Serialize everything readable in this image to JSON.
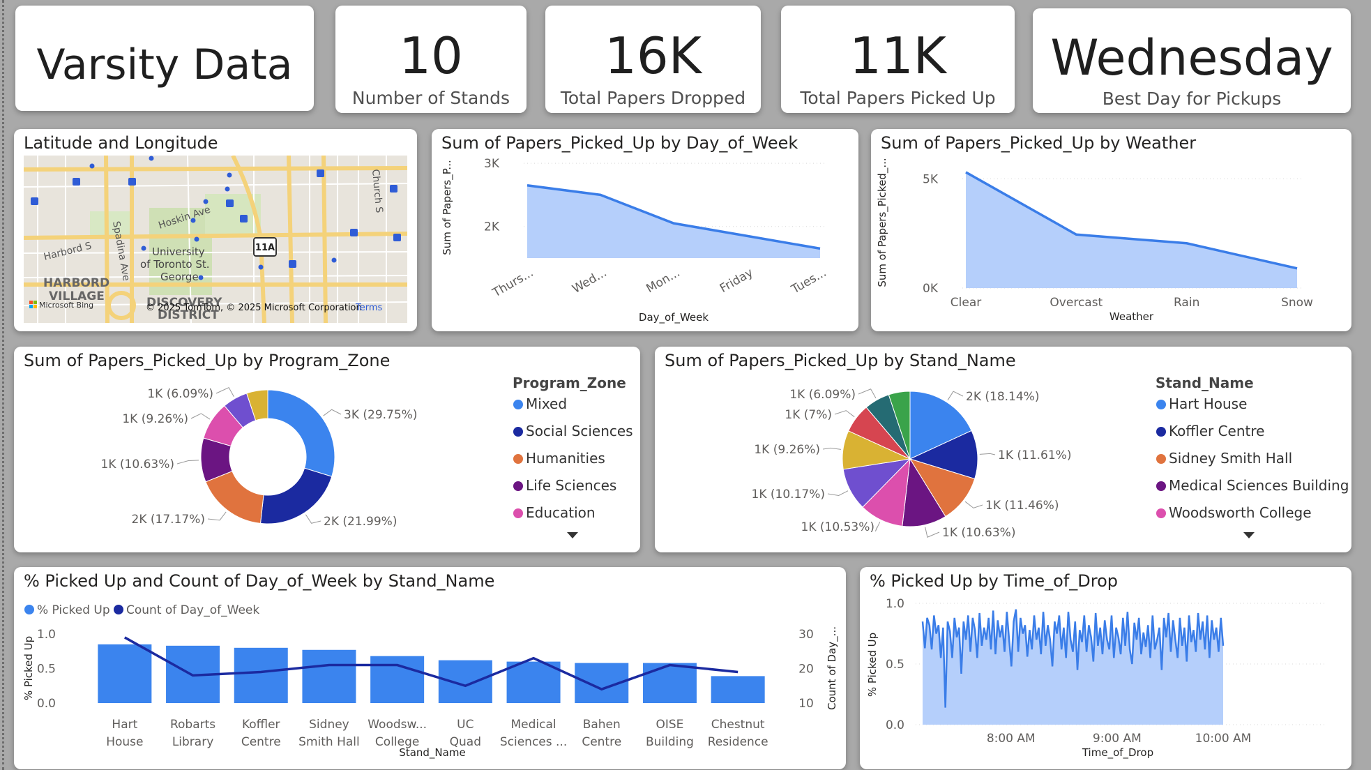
{
  "kpis": {
    "title": "Varsity Data",
    "stands_value": "10",
    "stands_label": "Number of Stands",
    "dropped_value": "16K",
    "dropped_label": "Total Papers Dropped",
    "picked_value": "11K",
    "picked_label": "Total Papers Picked Up",
    "bestday_value": "Wednesday",
    "bestday_label": "Best Day for Pickups"
  },
  "map": {
    "title": "Latitude and Longitude",
    "labels": [
      "Hoskin Ave",
      "University",
      "of Toronto St.",
      "George",
      "HARBORD",
      "VILLAGE",
      "DISCOVERY",
      "DISTRICT",
      "Harbord S",
      "Spadina Ave",
      "Church S",
      "11A"
    ],
    "attribution": "© 2025 TomTom, © 2025 Microsoft Corporation",
    "terms": "Terms",
    "bing": "Microsoft Bing",
    "colors": {
      "background": "#e8e4dc",
      "park": "#cfe0b5",
      "major_road": "#f4d27a",
      "minor_road": "#ffffff",
      "pin": "#2f5cd6"
    }
  },
  "chart_data": [
    {
      "id": "day_of_week",
      "type": "area",
      "title": "Sum of Papers_Picked_Up by Day_of_Week",
      "xlabel": "Day_of_Week",
      "ylabel": "Sum of Papers_P...",
      "categories": [
        "Thurs...",
        "Wed...",
        "Mon...",
        "Friday",
        "Tues..."
      ],
      "values": [
        2650,
        2500,
        2050,
        1850,
        1650
      ],
      "yticks": [
        "2K",
        "3K"
      ],
      "ylim": [
        1500,
        3100
      ],
      "color": "#3a7de8"
    },
    {
      "id": "weather",
      "type": "area",
      "title": "Sum of Papers_Picked_Up by Weather",
      "xlabel": "Weather",
      "ylabel": "Sum of Papers_Picked_...",
      "categories": [
        "Clear",
        "Overcast",
        "Rain",
        "Snow"
      ],
      "values": [
        5300,
        2450,
        2050,
        900
      ],
      "yticks": [
        "0K",
        "5K"
      ],
      "ylim": [
        0,
        6000
      ],
      "color": "#3a7de8"
    },
    {
      "id": "program_zone",
      "type": "pie",
      "donut": true,
      "title": "Sum of Papers_Picked_Up by Program_Zone",
      "legend_title": "Program_Zone",
      "legend": [
        "Mixed",
        "Social Sciences",
        "Humanities",
        "Life Sciences",
        "Education"
      ],
      "slices": [
        {
          "label": "3K (29.75%)",
          "value": 29.75,
          "color": "#3b84ee"
        },
        {
          "label": "2K (21.99%)",
          "value": 21.99,
          "color": "#1b2aa0"
        },
        {
          "label": "2K (17.17%)",
          "value": 17.17,
          "color": "#e0733e"
        },
        {
          "label": "1K (10.63%)",
          "value": 10.63,
          "color": "#6b1582"
        },
        {
          "label": "1K (9.26%)",
          "value": 9.26,
          "color": "#dc4fad"
        },
        {
          "label": "1K (6.09%)",
          "value": 6.09,
          "color": "#6f4fcf"
        },
        {
          "label": "",
          "value": 5.11,
          "color": "#d9b233"
        }
      ]
    },
    {
      "id": "stand_name",
      "type": "pie",
      "donut": false,
      "title": "Sum of Papers_Picked_Up by Stand_Name",
      "legend_title": "Stand_Name",
      "legend": [
        "Hart House",
        "Koffler Centre",
        "Sidney Smith Hall",
        "Medical Sciences Building",
        "Woodsworth College"
      ],
      "slices": [
        {
          "label": "2K (18.14%)",
          "value": 18.14,
          "color": "#3b84ee"
        },
        {
          "label": "1K (11.61%)",
          "value": 11.61,
          "color": "#1b2aa0"
        },
        {
          "label": "1K (11.46%)",
          "value": 11.46,
          "color": "#e0733e"
        },
        {
          "label": "1K (10.63%)",
          "value": 10.63,
          "color": "#6b1582"
        },
        {
          "label": "1K (10.53%)",
          "value": 10.53,
          "color": "#dc4fad"
        },
        {
          "label": "1K (10.17%)",
          "value": 10.17,
          "color": "#6f4fcf"
        },
        {
          "label": "1K (9.26%)",
          "value": 9.26,
          "color": "#d9b233"
        },
        {
          "label": "1K (7%)",
          "value": 7.0,
          "color": "#d64550"
        },
        {
          "label": "1K (6.09%)",
          "value": 6.09,
          "color": "#256b73"
        },
        {
          "label": "",
          "value": 5.11,
          "color": "#3aa34a"
        }
      ]
    },
    {
      "id": "stand_combo",
      "type": "bar",
      "title": "% Picked Up and Count of Day_of_Week by Stand_Name",
      "xlabel": "Stand_Name",
      "ylabel": "% Picked Up",
      "y2label": "Count of Day_...",
      "categories": [
        "Hart House",
        "Robarts Library",
        "Koffler Centre",
        "Sidney Smith Hall",
        "Woodsw... College",
        "UC Quad",
        "Medical Sciences ...",
        "Bahen Centre",
        "OISE Building",
        "Chestnut Residence"
      ],
      "series": [
        {
          "name": "% Picked Up",
          "type": "bar",
          "color": "#3b84ee",
          "values": [
            0.85,
            0.83,
            0.8,
            0.77,
            0.68,
            0.62,
            0.6,
            0.58,
            0.58,
            0.39
          ]
        },
        {
          "name": "Count of Day_of_Week",
          "type": "line",
          "color": "#1b2aa0",
          "values": [
            29,
            18,
            19,
            21,
            21,
            15,
            23,
            14,
            21,
            19
          ]
        }
      ],
      "yticks": [
        "0.0",
        "0.5",
        "1.0"
      ],
      "ylim": [
        0,
        1.0
      ],
      "y2ticks": [
        "10",
        "20",
        "30"
      ],
      "y2lim": [
        10,
        30
      ]
    },
    {
      "id": "time_of_drop",
      "type": "area",
      "title": "% Picked Up by Time_of_Drop",
      "xlabel": "Time_of_Drop",
      "ylabel": "% Picked Up",
      "xticks": [
        "8:00 AM",
        "9:00 AM",
        "10:00 AM"
      ],
      "yticks": [
        "0.0",
        "0.5",
        "1.0"
      ],
      "ylim": [
        0,
        1.0
      ],
      "x_start": "7:10 AM",
      "x_end": "10:00 AM",
      "values": [
        0.85,
        0.63,
        0.88,
        0.82,
        0.62,
        0.9,
        0.75,
        0.82,
        0.55,
        0.8,
        0.14,
        0.85,
        0.77,
        0.55,
        0.88,
        0.72,
        0.8,
        0.42,
        0.85,
        0.7,
        0.9,
        0.6,
        0.88,
        0.78,
        0.55,
        0.92,
        0.65,
        0.8,
        0.7,
        0.88,
        0.62,
        0.94,
        0.58,
        0.86,
        0.72,
        0.82,
        0.6,
        0.93,
        0.7,
        0.48,
        0.85,
        0.95,
        0.6,
        0.88,
        0.75,
        0.82,
        0.56,
        0.78,
        0.62,
        0.9,
        0.7,
        0.8,
        0.58,
        0.93,
        0.65,
        0.82,
        0.7,
        0.48,
        0.85,
        0.75,
        0.9,
        0.62,
        0.8,
        0.55,
        0.93,
        0.7,
        0.6,
        0.85,
        0.45,
        0.78,
        0.68,
        0.9,
        0.6,
        0.82,
        0.72,
        0.52,
        0.92,
        0.65,
        0.8,
        0.58,
        0.86,
        0.7,
        0.62,
        0.9,
        0.55,
        0.8,
        0.72,
        0.58,
        0.88,
        0.65,
        0.93,
        0.62,
        0.5,
        0.84,
        0.7,
        0.88,
        0.58,
        0.76,
        0.64,
        0.82,
        0.55,
        0.9,
        0.62,
        0.7,
        0.8,
        0.45,
        0.88,
        0.72,
        0.92,
        0.6,
        0.86,
        0.7,
        0.55,
        0.88,
        0.65,
        0.8,
        0.52,
        0.9,
        0.68,
        0.78,
        0.6,
        0.92,
        0.7,
        0.85,
        0.62,
        0.9,
        0.55,
        0.86,
        0.7,
        0.8,
        0.6,
        0.88,
        0.65
      ],
      "color": "#3a7de8"
    }
  ]
}
